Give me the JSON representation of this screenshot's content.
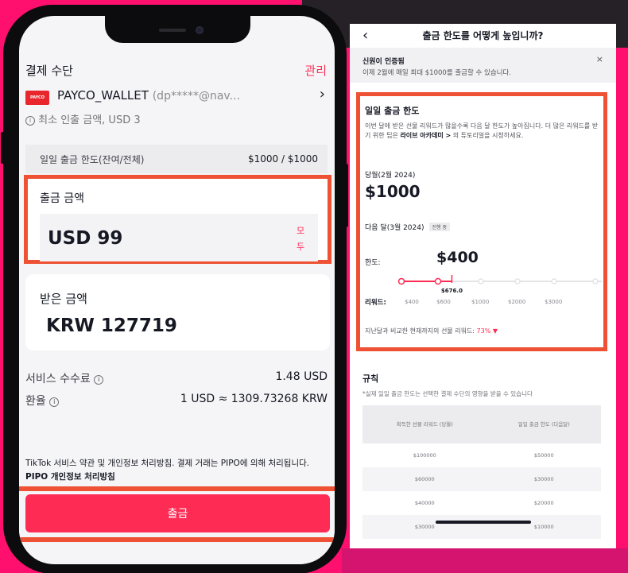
{
  "phone": {
    "payment_method_label": "결제 수단",
    "manage_label": "관리",
    "wallet": {
      "logo_text": "PAYCO",
      "name": "PAYCO_WALLET",
      "email": "(dp*****@nav...",
      "min_withdraw": "최소 인출 금액, USD 3"
    },
    "daily_limit": {
      "label": "일일 출금 한도(잔여/전체)",
      "value": "$1000 / $1000"
    },
    "withdraw_amount": {
      "label": "출금 금액",
      "value": "USD 99",
      "max_label": "모두"
    },
    "receive_amount": {
      "label": "받은 금액",
      "value": "KRW 127719"
    },
    "service_fee": {
      "label": "서비스 수수료",
      "value": "1.48 USD"
    },
    "exchange_rate": {
      "label": "환율",
      "value": "1 USD ≈ 1309.73268 KRW"
    },
    "terms": {
      "text": "TikTok 서비스 약관 및 개인정보 처리방침. 결제 거래는 PIPO에 의해 처리됩니다.",
      "link": "PIPO 개인정보 처리방침"
    },
    "withdraw_button": "출금"
  },
  "panel": {
    "title": "출금 한도를 어떻게 높입니까?",
    "banner": {
      "title": "신원이 인증됨",
      "text": "이제 2월에 매일 최대 $1000를 출금할 수 있습니다."
    },
    "daily_limit": {
      "title": "일일 출금 한도",
      "desc_1": "이번 달에 받은 선물 리워드가 많을수록 다음 달 한도가 높아집니다. 더 많은 리워드를 받기 위한 팁은",
      "desc_link": "라이브 아카데미 >",
      "desc_2": "의 튜토리얼을 시청하세요.",
      "current_label": "당월(2월 2024)",
      "current_value": "$1000",
      "next_label": "다음 달(3월 2024)",
      "next_badge": "진행 중",
      "limit_label": "한도:",
      "limit_value": "$400",
      "progress_value": "$676.0",
      "reward_label": "리워드:",
      "reward_ticks": [
        "$400",
        "$600",
        "$1000",
        "$2000",
        "$3000"
      ],
      "progress_fraction": 0.26,
      "drop_note": "지난달과 비교한 현재까지의 선물 리워드:",
      "drop_pct": "73%"
    },
    "rules": {
      "title": "규칙",
      "note": "*실제 일일 출금 한도는 선택한 결제 수단의 영향을 받을 수 있습니다",
      "col1": "획득한 선물 리워드 (당월)",
      "col2": "일일 출금 한도 (다음달)",
      "rows": [
        [
          "$100000",
          "$50000"
        ],
        [
          "$60000",
          "$30000"
        ],
        [
          "$40000",
          "$20000"
        ],
        [
          "$30000",
          "$10000"
        ]
      ]
    }
  },
  "colors": {
    "accent": "#fe2c55",
    "highlight": "#ee5133",
    "background": "#ff0f6e"
  }
}
